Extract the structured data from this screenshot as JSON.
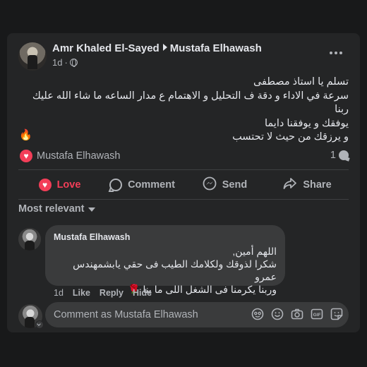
{
  "post": {
    "author": "Amr Khaled El-Sayed",
    "target": "Mustafa Elhawash",
    "time": "1d",
    "text_lines": [
      "تسلم يا استاذ مصطفى",
      "سرعة في الاداء و دقة ف التحليل و الاهتمام ع مدار الساعه ما شاء الله عليك ربنا",
      "يوفقك و يوفقنا دايما",
      "و يرزقك من حيث لا تحتسب"
    ],
    "emoji": "🔥"
  },
  "reactions": {
    "reactor": "Mustafa Elhawash",
    "comment_count": "1"
  },
  "actions": {
    "love": "Love",
    "comment": "Comment",
    "send": "Send",
    "share": "Share"
  },
  "sort": {
    "label": "Most relevant"
  },
  "comment": {
    "author": "Mustafa Elhawash",
    "lines": [
      "اللهم أمين,",
      "شكرا لذوقك ولكلامك الطيب فى حقي يابشمهندس عمرو",
      "وربنا يكرمنا فى الشغل اللى ما بنا"
    ],
    "emoji": "🌹",
    "time": "1d",
    "like": "Like",
    "reply": "Reply",
    "hide": "Hide"
  },
  "compose": {
    "placeholder": "Comment as Mustafa Elhawash"
  },
  "colors": {
    "card": "#242526",
    "bubble": "#3a3b3c",
    "love": "#f33e58",
    "muted": "#b0b3b8",
    "text": "#e4e6eb"
  }
}
